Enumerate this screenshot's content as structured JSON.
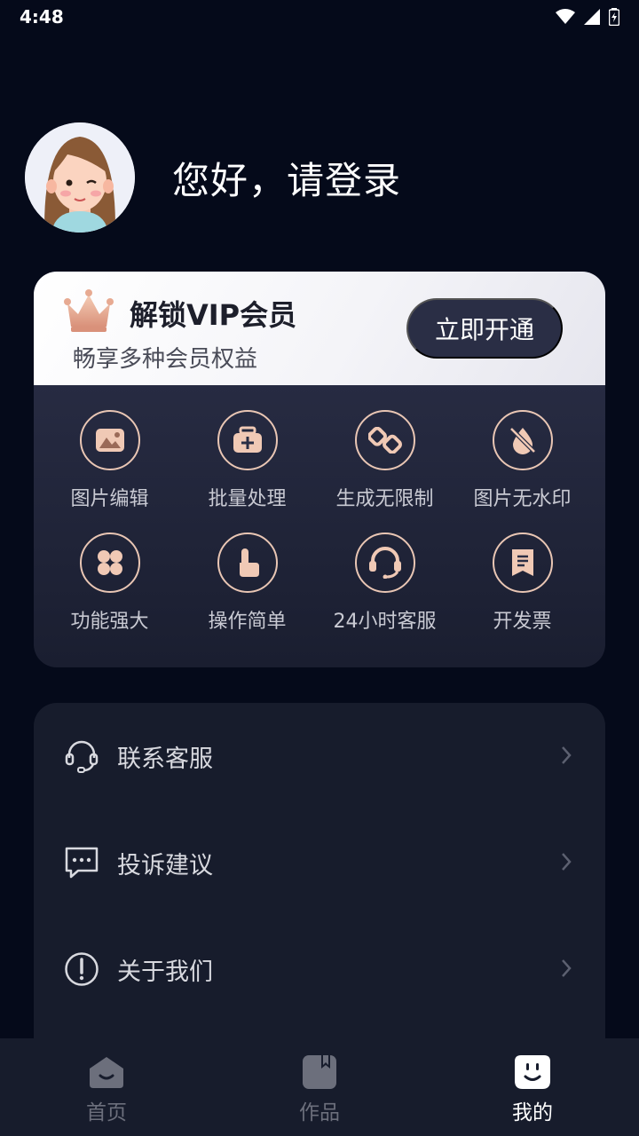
{
  "status_bar": {
    "time": "4:48"
  },
  "profile": {
    "greeting": "您好，请登录"
  },
  "vip": {
    "title": "解锁VIP会员",
    "subtitle": "畅享多种会员权益",
    "button": "立即开通",
    "benefits": [
      {
        "label": "图片编辑",
        "icon": "image-icon"
      },
      {
        "label": "批量处理",
        "icon": "batch-icon"
      },
      {
        "label": "生成无限制",
        "icon": "infinity-icon"
      },
      {
        "label": "图片无水印",
        "icon": "no-watermark-icon"
      },
      {
        "label": "功能强大",
        "icon": "grid-icon"
      },
      {
        "label": "操作简单",
        "icon": "tap-icon"
      },
      {
        "label": "24小时客服",
        "icon": "headset-icon"
      },
      {
        "label": "开发票",
        "icon": "invoice-icon"
      }
    ]
  },
  "menu": [
    {
      "label": "联系客服",
      "icon": "headset-icon"
    },
    {
      "label": "投诉建议",
      "icon": "message-icon"
    },
    {
      "label": "关于我们",
      "icon": "info-icon"
    }
  ],
  "nav": [
    {
      "label": "首页",
      "icon": "home-icon"
    },
    {
      "label": "作品",
      "icon": "works-icon"
    },
    {
      "label": "我的",
      "icon": "profile-icon",
      "active": true
    }
  ],
  "colors": {
    "background": "#050a1a",
    "accent": "#e9c6b4",
    "card": "#171c2c"
  }
}
